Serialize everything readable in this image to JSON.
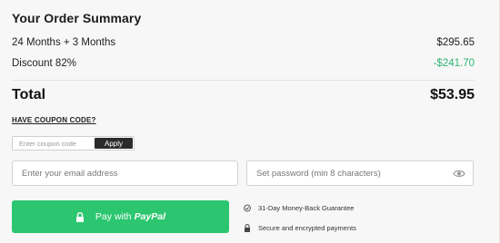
{
  "summary": {
    "title": "Your Order Summary",
    "items": [
      {
        "label": "24 Months + 3 Months",
        "value": "$295.65"
      },
      {
        "label": "Discount 82%",
        "value": "-$241.70"
      }
    ],
    "total_label": "Total",
    "total_value": "$53.95",
    "discount_color": "#2bb673"
  },
  "coupon": {
    "link_label": "HAVE COUPON CODE?",
    "placeholder": "Enter coupon code",
    "apply_label": "Apply"
  },
  "form": {
    "email_placeholder": "Enter your email address",
    "password_placeholder": "Set password (min 8 characters)"
  },
  "checkout": {
    "pay_prefix": "Pay with",
    "pay_brand": "PayPal",
    "button_color": "#2bc66f"
  },
  "guarantees": [
    {
      "icon": "shield-check-icon",
      "text": "31-Day Money-Back Guarantee"
    },
    {
      "icon": "lock-icon",
      "text": "Secure and encrypted payments"
    }
  ]
}
